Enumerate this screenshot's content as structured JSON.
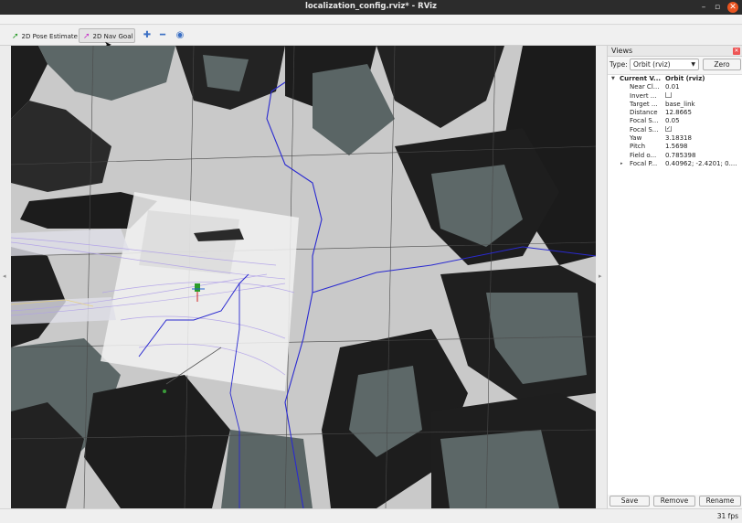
{
  "window": {
    "title": "localization_config.rviz* - RViz"
  },
  "toolbar": {
    "pose_estimate_label": "2D Pose Estimate",
    "nav_goal_label": "2D Nav Goal"
  },
  "views_panel": {
    "title": "Views",
    "type_label": "Type:",
    "type_value": "Orbit (rviz)",
    "zero_label": "Zero",
    "current_view_key": "Current V...",
    "current_view_value": "Orbit (rviz)",
    "props": [
      {
        "key": "Near Cl...",
        "value": "0.01"
      },
      {
        "key": "Invert ...",
        "value": ""
      },
      {
        "key": "Target ...",
        "value": "base_link"
      },
      {
        "key": "Distance",
        "value": "12.8665"
      },
      {
        "key": "Focal S...",
        "value": "0.05"
      },
      {
        "key": "Focal S...",
        "value": ""
      },
      {
        "key": "Yaw",
        "value": "3.18318"
      },
      {
        "key": "Pitch",
        "value": "1.5698"
      },
      {
        "key": "Field o...",
        "value": "0.785398"
      },
      {
        "key": "Focal P...",
        "value": "0.40962; -2.4201; 0...."
      }
    ],
    "invert_checked": false,
    "focal_shape_checked": true,
    "save_label": "Save",
    "remove_label": "Remove",
    "rename_label": "Rename"
  },
  "status": {
    "fps": "31 fps"
  },
  "colors": {
    "map_dark": "#1f1f1f",
    "map_mid": "#5e6a6a",
    "map_free": "#c8c8c8",
    "costmap_patch": "#f0f0f0",
    "global_path": "#2a2ad0",
    "accent": "#e95420"
  }
}
